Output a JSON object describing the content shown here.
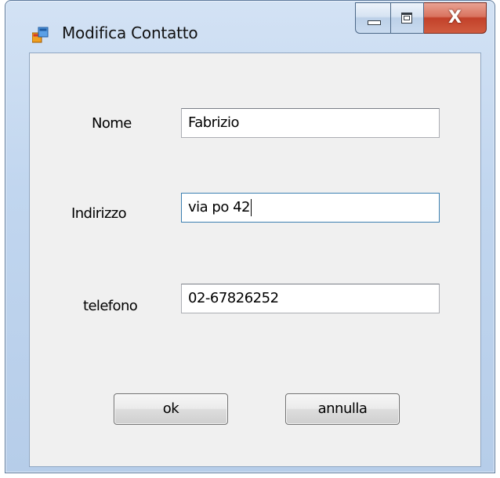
{
  "window": {
    "title": "Modifica Contatto",
    "icon": "window-app-icon",
    "caption_buttons": {
      "minimize_icon": "minimize-icon",
      "maximize_icon": "maximize-icon",
      "close_label": "X"
    }
  },
  "form": {
    "fields": [
      {
        "label": "Nome",
        "value": "Fabrizio"
      },
      {
        "label": "Indirizzo",
        "value": "via po 42"
      },
      {
        "label": "telefono",
        "value": "02-67826252"
      }
    ],
    "buttons": {
      "ok_label": "ok",
      "cancel_label": "annulla"
    }
  },
  "colors": {
    "frame": "#c1d6ef",
    "client_background": "#f0f0f0",
    "close_button": "#c2412a",
    "focus_border": "#3c7fb1"
  }
}
